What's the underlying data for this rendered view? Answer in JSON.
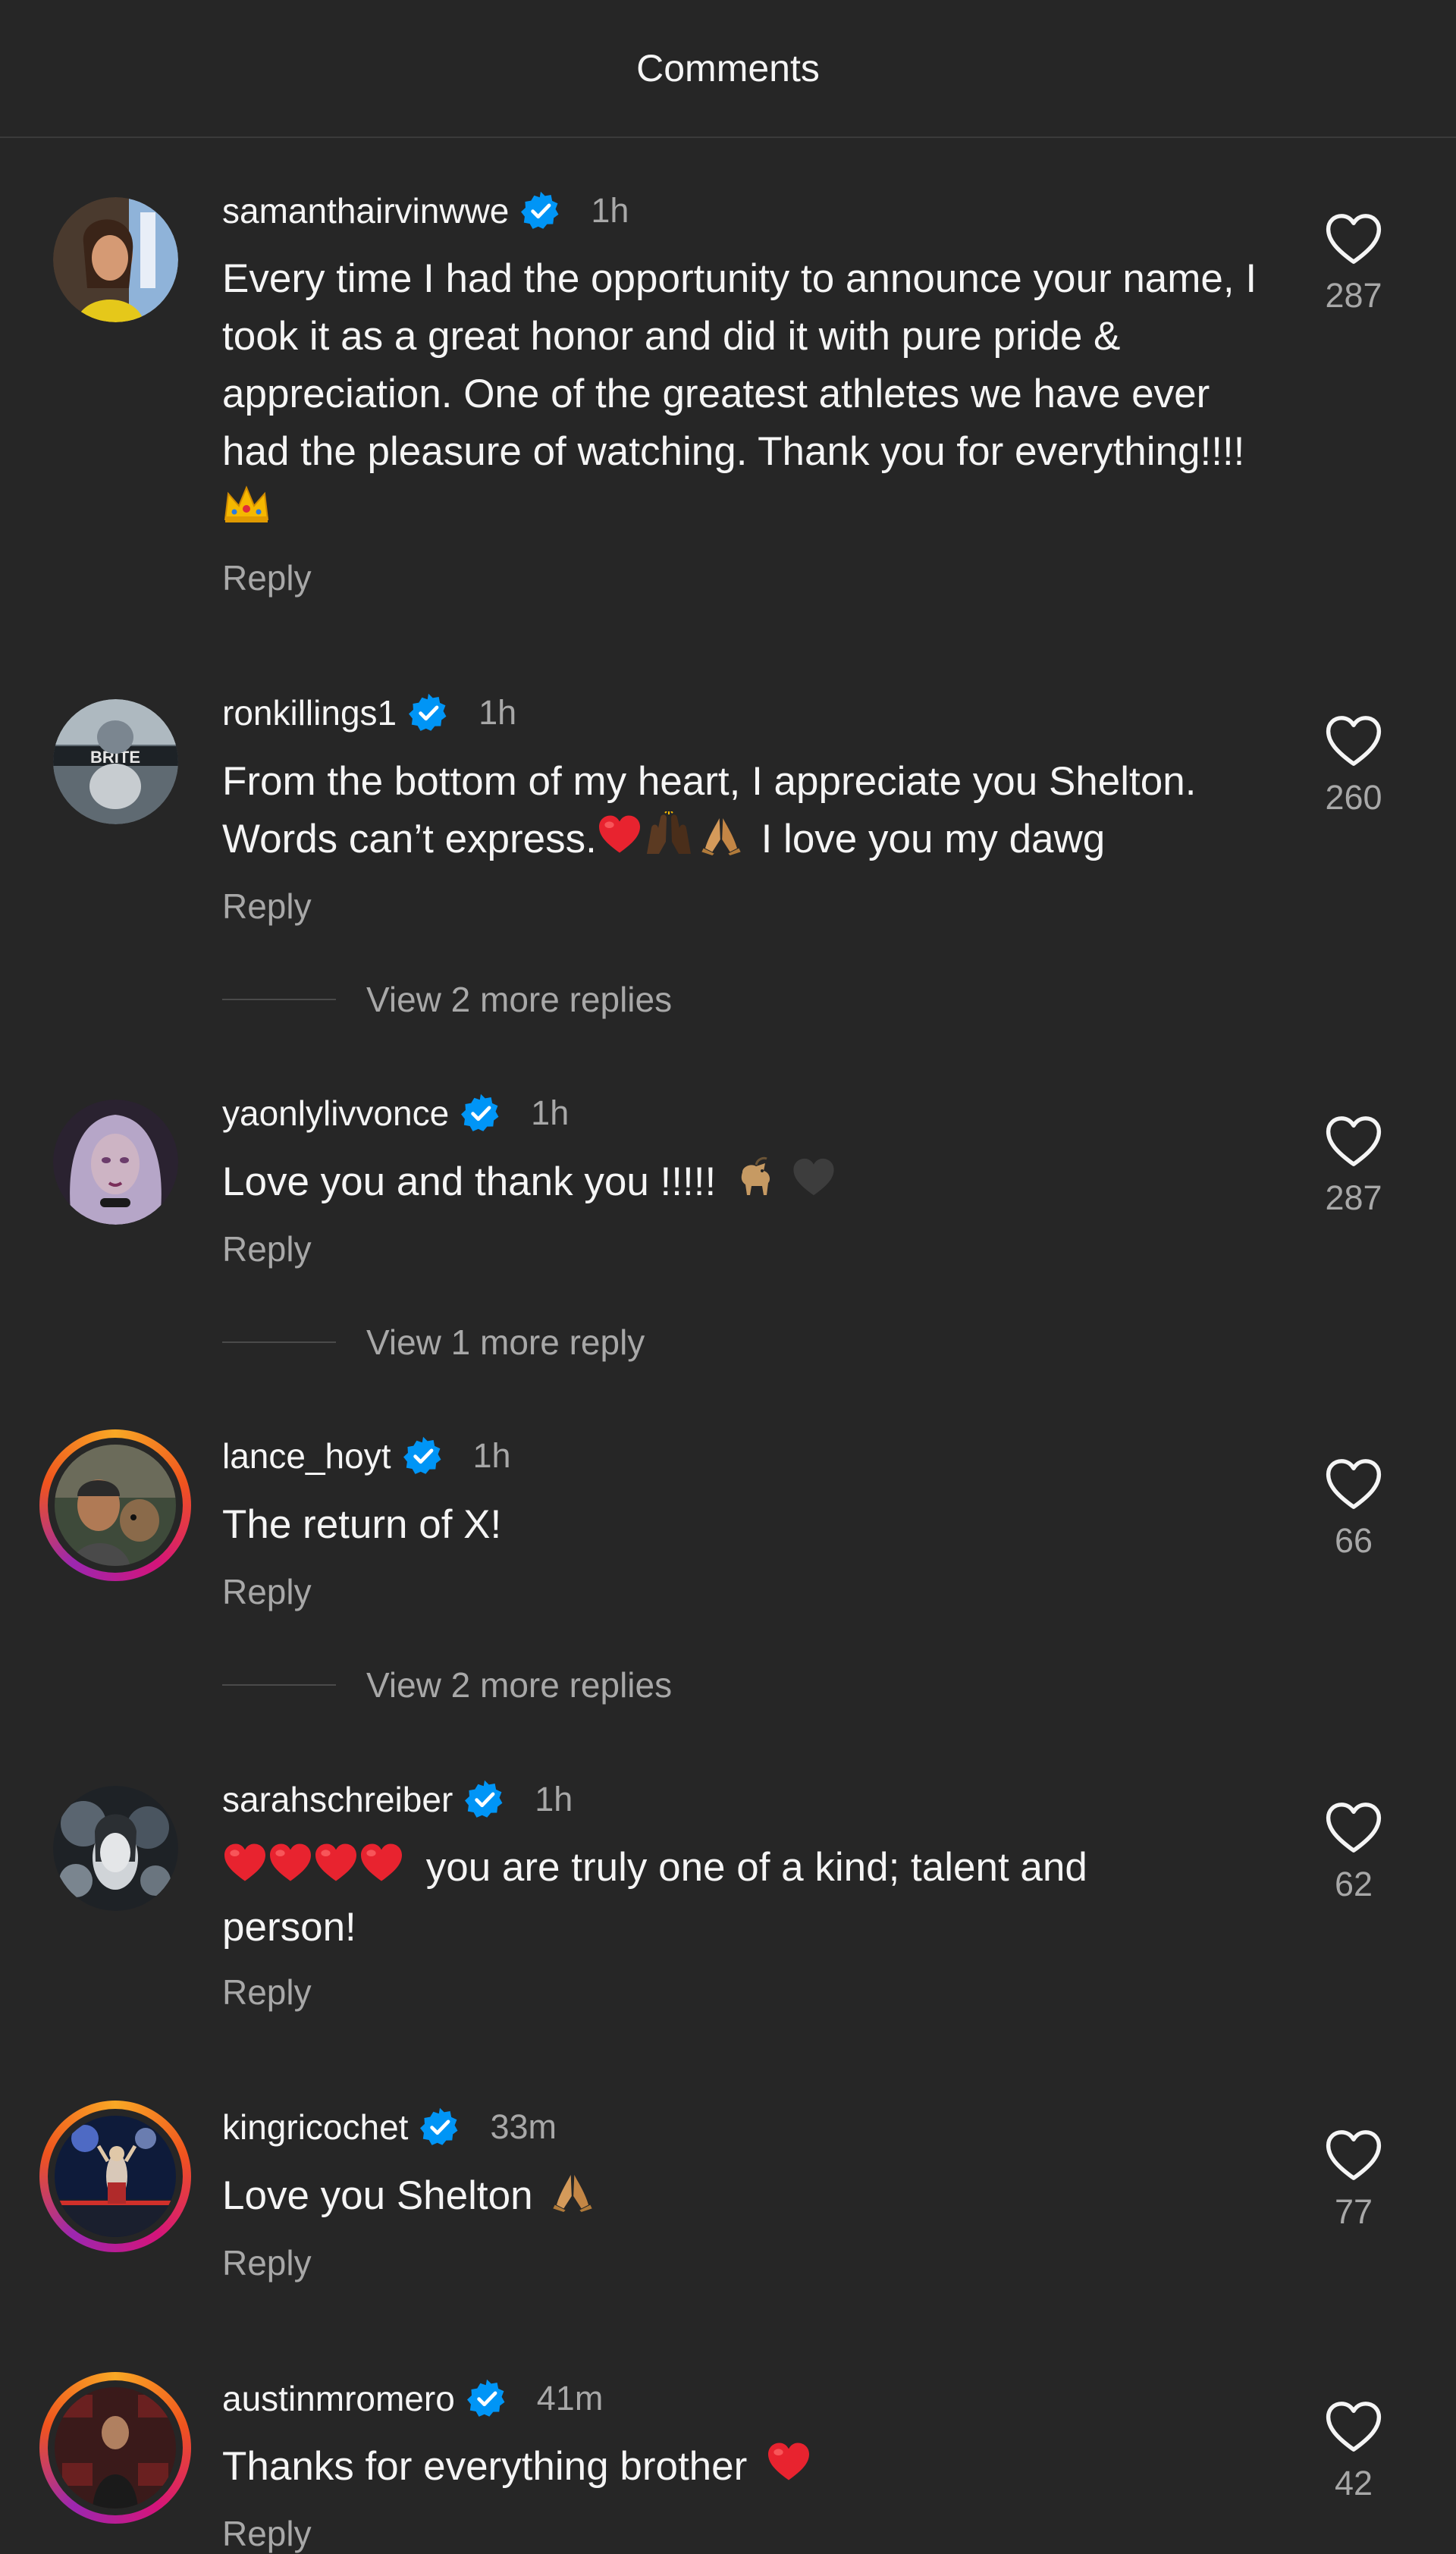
{
  "header": {
    "title": "Comments"
  },
  "comments": [
    {
      "username": "samanthairvinwwe",
      "time": "1h",
      "text": "Every time I had the opportunity to announce your name, I took it as a great honor and did it with pure pride & appreciation. One of the greatest athletes we have ever had the pleasure of watching. Thank you for everything!!!!",
      "likes": "287",
      "reply": "Reply"
    },
    {
      "username": "ronkillings1",
      "time": "1h",
      "text_line1": "From the bottom of my heart, I appreciate you Shelton.",
      "text_line2_a": "Words can’t express.",
      "text_line2_b": "I love you my dawg",
      "likes": "260",
      "reply": "Reply",
      "view_more": "View 2 more replies"
    },
    {
      "username": "yaonlylivvonce",
      "time": "1h",
      "text": "Love you and thank you !!!!!",
      "likes": "287",
      "reply": "Reply",
      "view_more": "View 1 more reply"
    },
    {
      "username": "lance_hoyt",
      "time": "1h",
      "text": "The return of X!",
      "likes": "66",
      "reply": "Reply",
      "view_more": "View 2 more replies"
    },
    {
      "username": "sarahschreiber",
      "time": "1h",
      "text_line1": "you are truly one of a kind; talent and",
      "text_line2": "person!",
      "likes": "62",
      "reply": "Reply"
    },
    {
      "username": "kingricochet",
      "time": "33m",
      "text": "Love you Shelton",
      "likes": "77",
      "reply": "Reply"
    },
    {
      "username": "austinmromero",
      "time": "41m",
      "text": "Thanks for everything brother",
      "likes": "42",
      "reply": "Reply"
    }
  ],
  "icons": {
    "verified": "verified-badge-icon",
    "like": "heart-outline-icon"
  },
  "colors": {
    "background": "#262626",
    "verified": "#0095f6",
    "muted": "#a8a8a8",
    "heart_emoji": "#e0245e"
  }
}
